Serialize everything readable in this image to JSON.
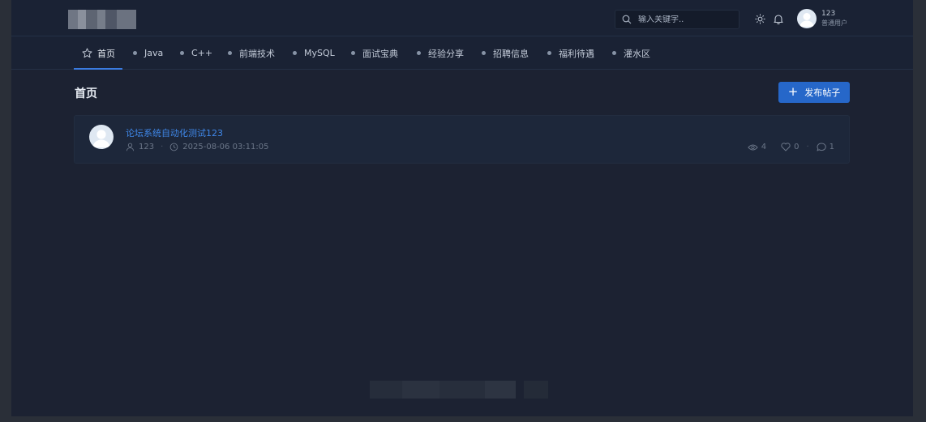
{
  "header": {
    "search": {
      "placeholder": "输入关键字..",
      "value": ""
    },
    "user": {
      "name": "123",
      "role": "普通用户"
    }
  },
  "nav": {
    "items": [
      {
        "label": "首页",
        "active": true
      },
      {
        "label": "Java"
      },
      {
        "label": "C++"
      },
      {
        "label": "前端技术"
      },
      {
        "label": "MySQL"
      },
      {
        "label": "面试宝典"
      },
      {
        "label": "经验分享"
      },
      {
        "label": "招聘信息"
      },
      {
        "label": "福利待遇"
      },
      {
        "label": "灌水区"
      }
    ]
  },
  "main": {
    "title": "首页",
    "publish_label": "发布帖子",
    "posts": [
      {
        "title": "论坛系统自动化测试123",
        "author": "123",
        "time": "2025-08-06 03:11:05",
        "views": "4",
        "likes": "0",
        "comments": "1"
      }
    ]
  },
  "colors": {
    "accent": "#2667c9",
    "link": "#3f87e8",
    "background": "#1c2232",
    "header": "#1a2234"
  }
}
